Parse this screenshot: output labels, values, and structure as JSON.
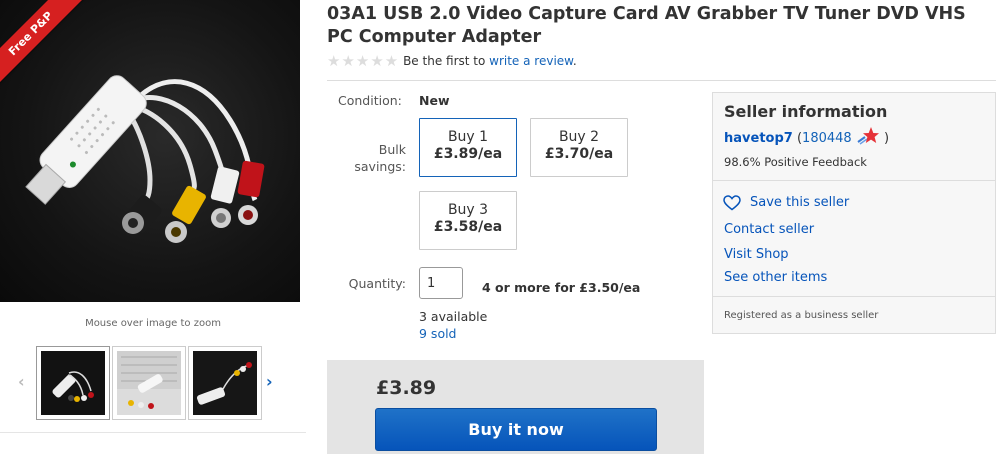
{
  "gallery": {
    "badge": "Free P&P",
    "zoom_hint": "Mouse over image to zoom",
    "prev_icon": "chevron-left-icon",
    "next_icon": "chevron-right-icon",
    "thumb_count": 3
  },
  "listing": {
    "title": "03A1 USB 2.0 Video Capture Card AV Grabber TV Tuner DVD VHS PC Computer Adapter",
    "rating_stars": 0,
    "rating_max": 5,
    "review_prefix": "Be the first to ",
    "review_link": "write a review",
    "review_suffix": "."
  },
  "purchase": {
    "condition_label": "Condition:",
    "condition_value": "New",
    "bulk_label": "Bulk savings:",
    "bulk_options": [
      {
        "qty": "Buy 1",
        "price": "£3.89/ea",
        "selected": true
      },
      {
        "qty": "Buy 2",
        "price": "£3.70/ea",
        "selected": false
      },
      {
        "qty": "Buy 3",
        "price": "£3.58/ea",
        "selected": false
      }
    ],
    "quantity_label": "Quantity:",
    "quantity_value": "1",
    "quantity_offer": "4 or more for £3.50/ea",
    "available": "3 available",
    "sold": "9 sold",
    "price": "£3.89",
    "buy_button": "Buy it now"
  },
  "seller": {
    "heading": "Seller information",
    "name": "havetop7",
    "open_paren": "(",
    "score": "180448",
    "close_paren": ")",
    "feedback": "98.6% Positive Feedback",
    "save_label": "Save this seller",
    "contact_label": "Contact seller",
    "shop_label": "Visit Shop",
    "other_label": "See other items",
    "registered": "Registered as a business seller"
  },
  "colors": {
    "link": "#0654ba",
    "buy_button": "#0654ba",
    "badge": "#d62020",
    "star_rating": "#e53238"
  }
}
